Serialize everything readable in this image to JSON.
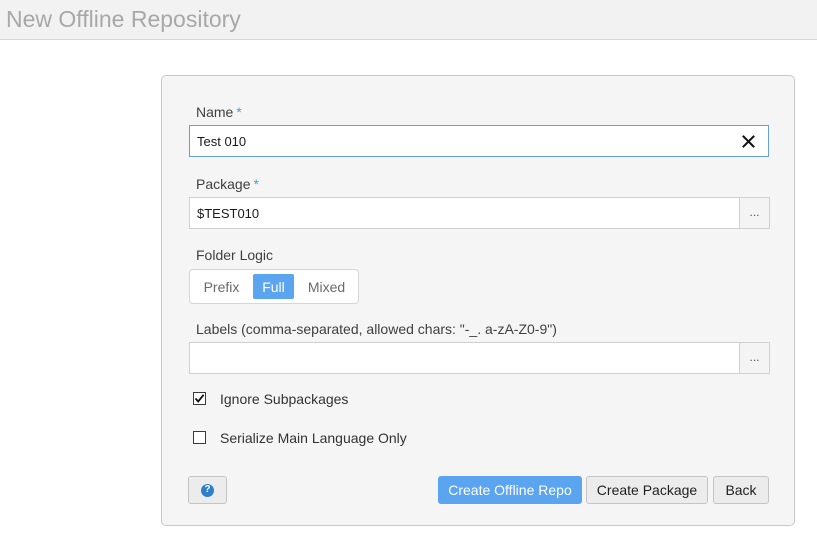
{
  "header": {
    "title": "New Offline Repository"
  },
  "form": {
    "name": {
      "label": "Name",
      "required_mark": "*",
      "value": "Test 010",
      "clear_icon": "close-icon"
    },
    "package": {
      "label": "Package",
      "required_mark": "*",
      "value": "$TEST010",
      "value_help": "..."
    },
    "folder_logic": {
      "label": "Folder Logic",
      "options": [
        "Prefix",
        "Full",
        "Mixed"
      ],
      "selected": "Full"
    },
    "labels": {
      "label": "Labels (comma-separated, allowed chars: \"-_. a-zA-Z0-9\")",
      "value": "",
      "value_help": "..."
    },
    "ignore_subpackages": {
      "label": "Ignore Subpackages",
      "checked": true
    },
    "serialize_main_language": {
      "label": "Serialize Main Language Only",
      "checked": false
    }
  },
  "buttons": {
    "help_icon": "question-circle-icon",
    "help_glyph": "?",
    "create_offline_repo": "Create Offline Repo",
    "create_package": "Create Package",
    "back": "Back"
  },
  "colors": {
    "accent": "#5ba4ef",
    "required": "#4a9ed9",
    "help_icon": "#2f7fcf",
    "title_text": "#a8a8a8"
  }
}
